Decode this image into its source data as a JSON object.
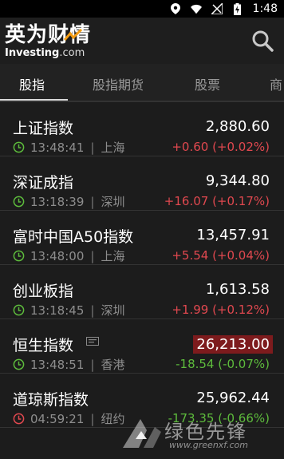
{
  "status_bar": {
    "time": "1:48"
  },
  "header": {
    "logo_cn": "英为财情",
    "logo_brand": "Investing",
    "logo_suffix": ".com"
  },
  "tabs": [
    {
      "label": "股指",
      "active": true
    },
    {
      "label": "股指期货",
      "active": false
    },
    {
      "label": "股票",
      "active": false
    },
    {
      "label": "商",
      "active": false
    }
  ],
  "indices": [
    {
      "name": "上证指数",
      "price": "2,880.60",
      "time": "13:48:41",
      "market": "上海",
      "change": "+0.60 (+0.02%)",
      "direction": "up"
    },
    {
      "name": "深证成指",
      "price": "9,344.80",
      "time": "13:18:39",
      "market": "深圳",
      "change": "+16.07 (+0.17%)",
      "direction": "up"
    },
    {
      "name": "富时中国A50指数",
      "price": "13,457.91",
      "time": "13:48:00",
      "market": "上海",
      "change": "+5.54 (+0.04%)",
      "direction": "up"
    },
    {
      "name": "创业板指",
      "price": "1,613.58",
      "time": "13:18:45",
      "market": "深圳",
      "change": "+1.99 (+0.12%)",
      "direction": "up"
    },
    {
      "name": "恒生指数",
      "price": "26,213.00",
      "time": "13:48:51",
      "market": "香港",
      "change": "-18.54 (-0.07%)",
      "direction": "down",
      "highlight": true
    },
    {
      "name": "道琼斯指数",
      "price": "25,962.44",
      "time": "04:59:21",
      "market": "纽约",
      "change": "-173.35 (-0.66%)",
      "direction": "down",
      "closed": true
    }
  ],
  "colors": {
    "up": "#e0484f",
    "down": "#5dbb3c",
    "clock_open": "#5dbb3c",
    "clock_closed": "#e0484f",
    "highlight_bg": "#7d1b1d"
  },
  "watermark": {
    "cn": "绿色先锋",
    "en": "www.greenxf.com"
  }
}
